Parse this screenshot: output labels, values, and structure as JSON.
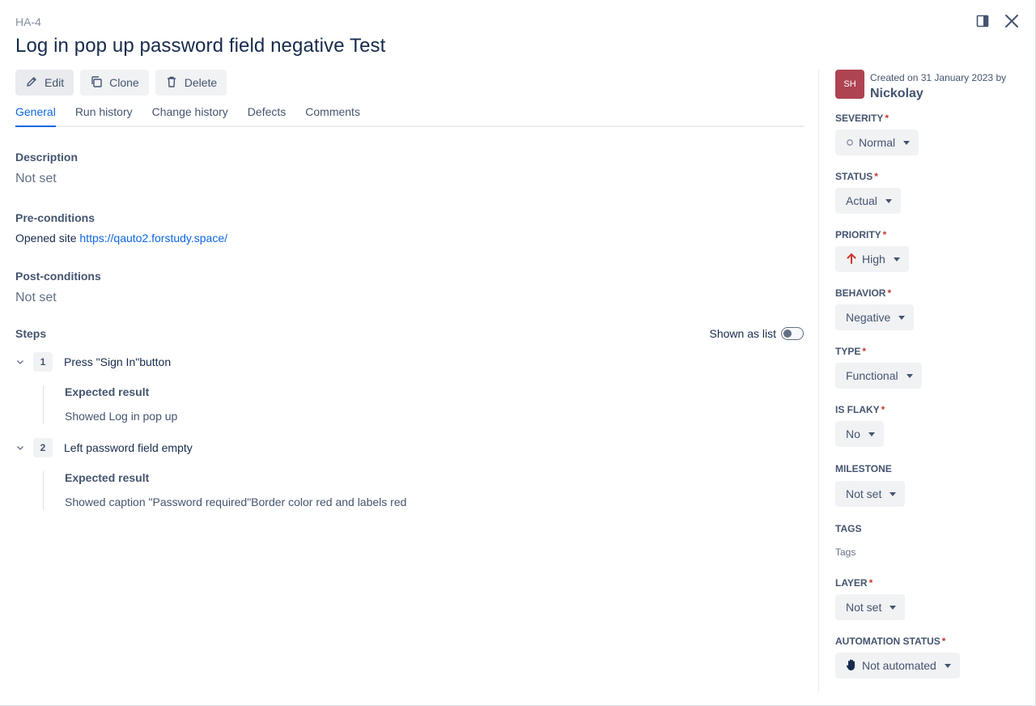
{
  "case": {
    "key": "HA-4",
    "title": "Log in pop up password field negative Test"
  },
  "window_icons": [
    "sidebar-panel-icon",
    "close-icon"
  ],
  "actions": {
    "edit": "Edit",
    "clone": "Clone",
    "delete": "Delete"
  },
  "tabs": [
    "General",
    "Run history",
    "Change history",
    "Defects",
    "Comments"
  ],
  "general": {
    "description_label": "Description",
    "description_value": "Not set",
    "preconditions_label": "Pre-conditions",
    "preconditions_text": "Opened site ",
    "preconditions_link": "https://qauto2.forstudy.space/",
    "postconditions_label": "Post-conditions",
    "postconditions_value": "Not set",
    "steps_label": "Steps",
    "shown_as_list": "Shown as list"
  },
  "steps": [
    {
      "num": "1",
      "text": "Press \"Sign In\"button",
      "expected_label": "Expected result",
      "expected": "Showed Log in pop up"
    },
    {
      "num": "2",
      "text": "Left password field empty",
      "expected_label": "Expected result",
      "expected": "Showed caption \"Password required\"Border color red and labels red"
    }
  ],
  "sidebar": {
    "avatar": "SH",
    "created": "Created on 31 January 2023 by",
    "author": "Nickolay",
    "fields": [
      {
        "label": "SEVERITY",
        "required": "*",
        "value": "Normal",
        "icon": "circle-icon"
      },
      {
        "label": "STATUS",
        "required": "*",
        "value": "Actual"
      },
      {
        "label": "PRIORITY",
        "required": "*",
        "value": "High",
        "icon": "arrow-up-icon"
      },
      {
        "label": "BEHAVIOR",
        "required": "*",
        "value": "Negative"
      },
      {
        "label": "TYPE",
        "required": "*",
        "value": "Functional"
      },
      {
        "label": "IS FLAKY",
        "required": "*",
        "value": "No"
      },
      {
        "label": "MILESTONE",
        "required": "",
        "value": "Not set"
      },
      {
        "label": "TAGS",
        "required": "",
        "placeholder": "Tags"
      },
      {
        "label": "LAYER",
        "required": "*",
        "value": "Not set"
      },
      {
        "label": "AUTOMATION STATUS",
        "required": "*",
        "value": "Not automated",
        "icon": "hand-icon"
      }
    ]
  },
  "colors": {
    "accent": "#0c66e4",
    "required": "#c9372c",
    "priority_high": "#c9372c",
    "avatar_bg": "#ae4452"
  }
}
